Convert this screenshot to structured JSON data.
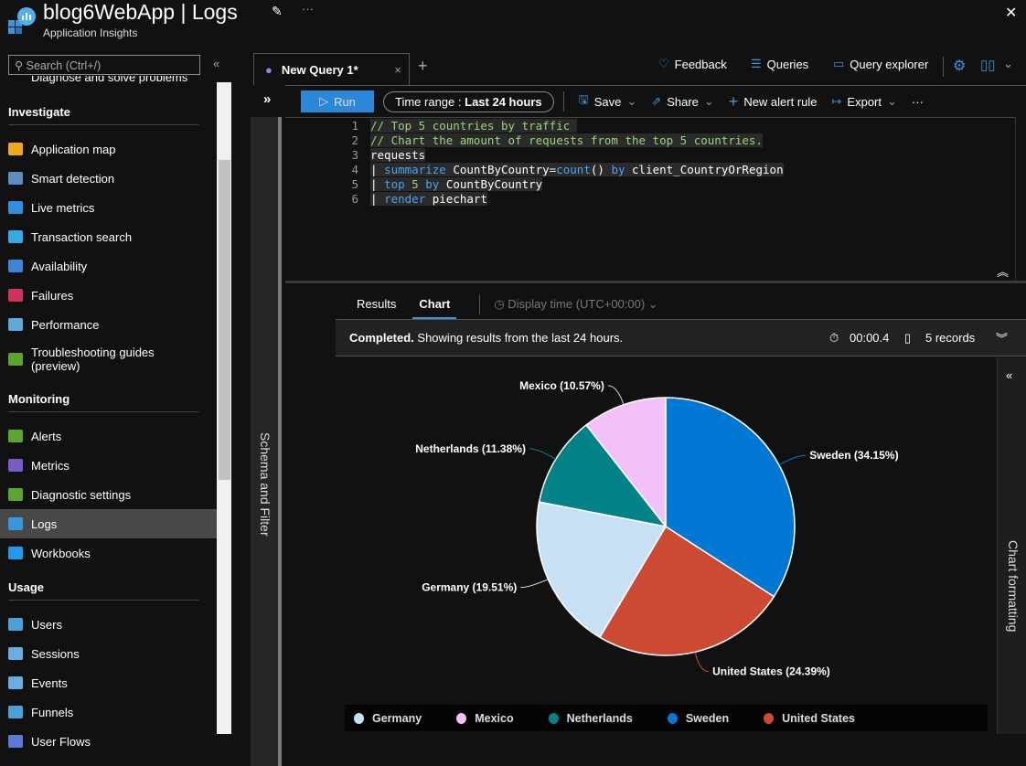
{
  "header": {
    "title": "blog6WebApp | Logs",
    "subtitle": "Application Insights",
    "pin_icon": "pin-icon",
    "more": "···",
    "close": "✕"
  },
  "sidebar": {
    "search_placeholder": "Search (Ctrl+/)",
    "collapse": "«",
    "partial_item": "Diagnose and solve problems",
    "sections": [
      {
        "title": "Investigate",
        "items": [
          {
            "label": "Application map",
            "color": "#f2a81d"
          },
          {
            "label": "Smart detection",
            "color": "#5a8fbf"
          },
          {
            "label": "Live metrics",
            "color": "#2f8fe0"
          },
          {
            "label": "Transaction search",
            "color": "#38a7e6"
          },
          {
            "label": "Availability",
            "color": "#3c85d8"
          },
          {
            "label": "Failures",
            "color": "#d0325e"
          },
          {
            "label": "Performance",
            "color": "#5fa8d8"
          },
          {
            "label": "Troubleshooting guides (preview)",
            "color": "#5ea52c"
          }
        ]
      },
      {
        "title": "Monitoring",
        "items": [
          {
            "label": "Alerts",
            "color": "#5ea52c"
          },
          {
            "label": "Metrics",
            "color": "#7a5bc9"
          },
          {
            "label": "Diagnostic settings",
            "color": "#5ea52c"
          },
          {
            "label": "Logs",
            "color": "#3a96dd",
            "selected": true
          },
          {
            "label": "Workbooks",
            "color": "#1f9bea"
          }
        ]
      },
      {
        "title": "Usage",
        "items": [
          {
            "label": "Users",
            "color": "#4aa3d8"
          },
          {
            "label": "Sessions",
            "color": "#6aaee0"
          },
          {
            "label": "Events",
            "color": "#6aaee0"
          },
          {
            "label": "Funnels",
            "color": "#4aa3d8"
          },
          {
            "label": "User Flows",
            "color": "#5a7bd8"
          }
        ]
      }
    ]
  },
  "query_tab": {
    "label": "New Query 1*",
    "close": "×",
    "add": "+"
  },
  "top_actions": {
    "feedback": "Feedback",
    "queries": "Queries",
    "query_explorer": "Query explorer"
  },
  "toolbar": {
    "run": "Run",
    "time_range_label": "Time range :",
    "time_range_value": "Last 24 hours",
    "save": "Save",
    "share": "Share",
    "new_alert_rule": "New alert rule",
    "export": "Export",
    "more": "···",
    "expand": "»"
  },
  "schema_panel": "Schema and Filter",
  "editor": {
    "lines": [
      {
        "n": "1",
        "parts": [
          {
            "t": "// Top 5 countries by traffic ",
            "c": "cm"
          }
        ]
      },
      {
        "n": "2",
        "parts": [
          {
            "t": "// Chart the amount of requests from the top 5 countries.",
            "c": "cm"
          }
        ]
      },
      {
        "n": "3",
        "parts": [
          {
            "t": "requests",
            "c": ""
          }
        ]
      },
      {
        "n": "4",
        "parts": [
          {
            "t": "| ",
            "c": ""
          },
          {
            "t": "summarize",
            "c": "kw"
          },
          {
            "t": " CountByCountry=",
            "c": ""
          },
          {
            "t": "count",
            "c": "kw"
          },
          {
            "t": "() ",
            "c": ""
          },
          {
            "t": "by",
            "c": "kw"
          },
          {
            "t": " client_CountryOrRegion",
            "c": ""
          }
        ]
      },
      {
        "n": "5",
        "parts": [
          {
            "t": "| ",
            "c": ""
          },
          {
            "t": "top",
            "c": "kw"
          },
          {
            "t": " ",
            "c": ""
          },
          {
            "t": "5",
            "c": "num"
          },
          {
            "t": " ",
            "c": ""
          },
          {
            "t": "by",
            "c": "kw"
          },
          {
            "t": " CountByCountry",
            "c": ""
          }
        ]
      },
      {
        "n": "6",
        "parts": [
          {
            "t": "| ",
            "c": ""
          },
          {
            "t": "render",
            "c": "kw"
          },
          {
            "t": " piechart",
            "c": ""
          }
        ]
      }
    ]
  },
  "results": {
    "tabs": [
      "Results",
      "Chart"
    ],
    "active": "Chart",
    "display_time": "Display time (UTC+00:00)"
  },
  "status": {
    "bold": "Completed.",
    "text": " Showing results from the last 24 hours.",
    "duration": "00:00.4",
    "records": "5 records"
  },
  "chart_formatting": "Chart formatting",
  "chart_data": {
    "type": "pie",
    "slices": [
      {
        "label": "Sweden",
        "value": 34.15,
        "color": "#0078d4"
      },
      {
        "label": "United States",
        "value": 24.39,
        "color": "#cc4a32"
      },
      {
        "label": "Germany",
        "value": 19.51,
        "color": "#c7e0f4"
      },
      {
        "label": "Netherlands",
        "value": 11.38,
        "color": "#038387"
      },
      {
        "label": "Mexico",
        "value": 10.57,
        "color": "#f4c0f8"
      }
    ],
    "data_labels": [
      "Sweden (34.15%)",
      "United States (24.39%)",
      "Germany (19.51%)",
      "Netherlands (11.38%)",
      "Mexico (10.57%)"
    ],
    "legend": [
      "Germany",
      "Mexico",
      "Netherlands",
      "Sweden",
      "United States"
    ],
    "legend_placement": "bottom"
  }
}
